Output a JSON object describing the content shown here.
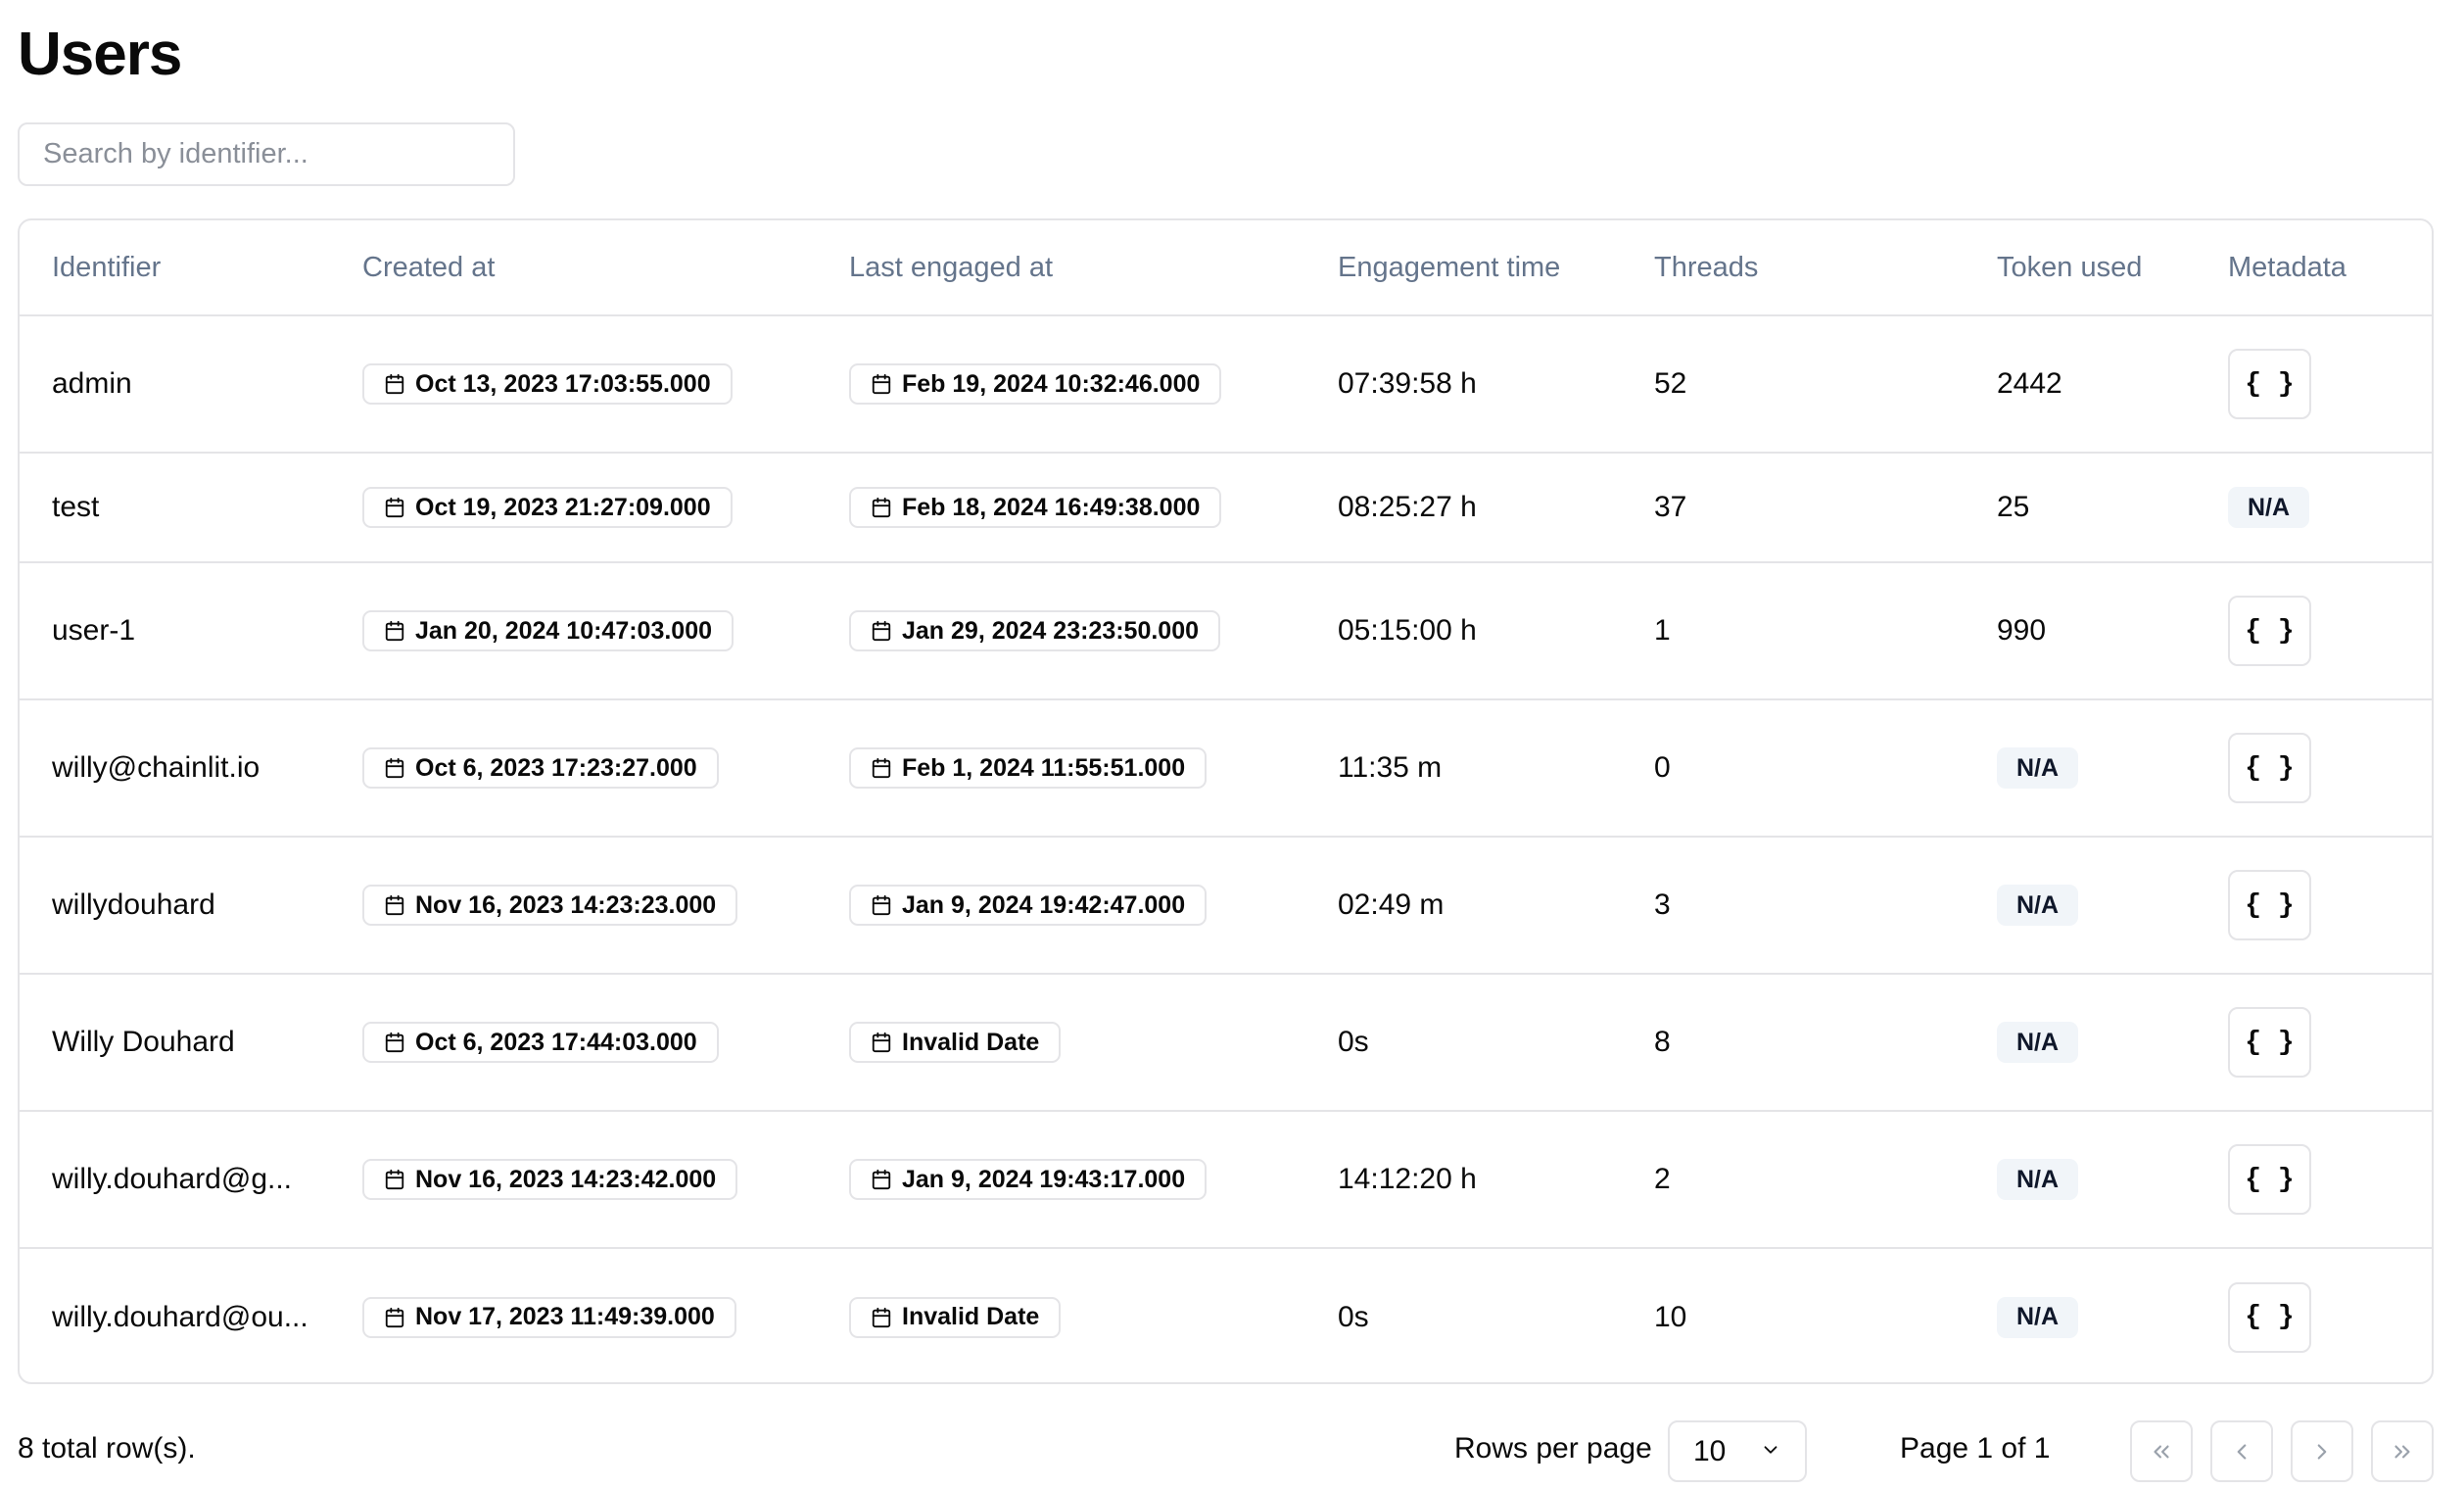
{
  "page": {
    "title": "Users"
  },
  "search": {
    "placeholder": "Search by identifier..."
  },
  "table": {
    "headers": {
      "identifier": "Identifier",
      "created_at": "Created at",
      "last_engaged_at": "Last engaged at",
      "engagement_time": "Engagement time",
      "threads": "Threads",
      "token_used": "Token used",
      "metadata": "Metadata"
    },
    "rows": [
      {
        "identifier": "admin",
        "created_at": "Oct 13, 2023 17:03:55.000",
        "last_engaged_at": "Feb 19, 2024 10:32:46.000",
        "engagement_time": "07:39:58 h",
        "threads": "52",
        "token_used": "2442",
        "token_na": false,
        "metadata": "{ }",
        "metadata_na": false
      },
      {
        "identifier": "test",
        "created_at": "Oct 19, 2023 21:27:09.000",
        "last_engaged_at": "Feb 18, 2024 16:49:38.000",
        "engagement_time": "08:25:27 h",
        "threads": "37",
        "token_used": "25",
        "token_na": false,
        "metadata": "N/A",
        "metadata_na": true
      },
      {
        "identifier": "user-1",
        "created_at": "Jan 20, 2024 10:47:03.000",
        "last_engaged_at": "Jan 29, 2024 23:23:50.000",
        "engagement_time": "05:15:00 h",
        "threads": "1",
        "token_used": "990",
        "token_na": false,
        "metadata": "{ }",
        "metadata_na": false
      },
      {
        "identifier": "willy@chainlit.io",
        "created_at": "Oct 6, 2023 17:23:27.000",
        "last_engaged_at": "Feb 1, 2024 11:55:51.000",
        "engagement_time": "11:35 m",
        "threads": "0",
        "token_used": "N/A",
        "token_na": true,
        "metadata": "{ }",
        "metadata_na": false
      },
      {
        "identifier": "willydouhard",
        "created_at": "Nov 16, 2023 14:23:23.000",
        "last_engaged_at": "Jan 9, 2024 19:42:47.000",
        "engagement_time": "02:49 m",
        "threads": "3",
        "token_used": "N/A",
        "token_na": true,
        "metadata": "{ }",
        "metadata_na": false
      },
      {
        "identifier": "Willy Douhard",
        "created_at": "Oct 6, 2023 17:44:03.000",
        "last_engaged_at": "Invalid Date",
        "engagement_time": "0s",
        "threads": "8",
        "token_used": "N/A",
        "token_na": true,
        "metadata": "{ }",
        "metadata_na": false
      },
      {
        "identifier": "willy.douhard@g...",
        "created_at": "Nov 16, 2023 14:23:42.000",
        "last_engaged_at": "Jan 9, 2024 19:43:17.000",
        "engagement_time": "14:12:20 h",
        "threads": "2",
        "token_used": "N/A",
        "token_na": true,
        "metadata": "{ }",
        "metadata_na": false
      },
      {
        "identifier": "willy.douhard@ou...",
        "created_at": "Nov 17, 2023 11:49:39.000",
        "last_engaged_at": "Invalid Date",
        "engagement_time": "0s",
        "threads": "10",
        "token_used": "N/A",
        "token_na": true,
        "metadata": "{ }",
        "metadata_na": false
      }
    ]
  },
  "footer": {
    "total_rows": "8 total row(s).",
    "rows_per_page_label": "Rows per page",
    "rows_per_page_value": "10",
    "page_info": "Page 1 of 1"
  },
  "icons": {
    "date": "calendar-icon",
    "select": "chevron-down-icon",
    "first": "chevrons-left-icon",
    "prev": "chevron-left-icon",
    "next": "chevron-right-icon",
    "last": "chevrons-right-icon"
  }
}
